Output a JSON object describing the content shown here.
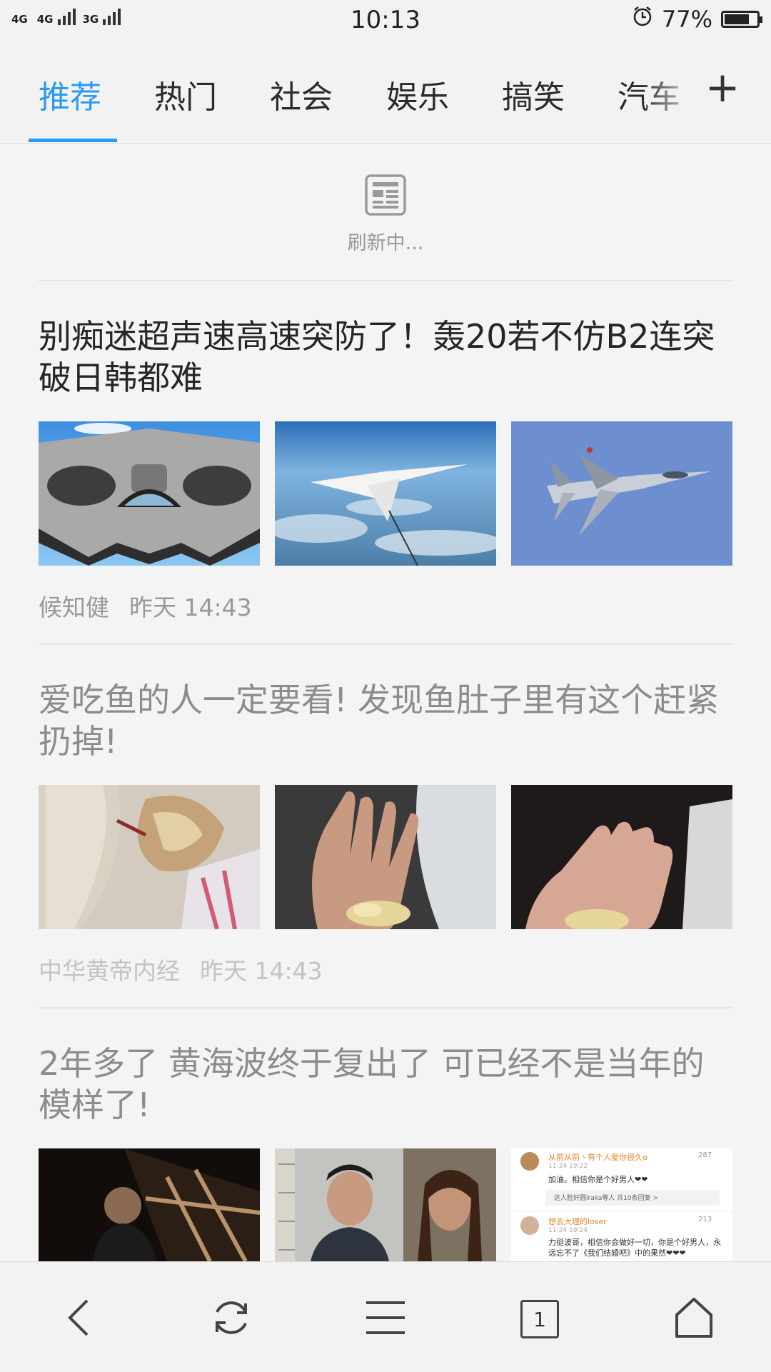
{
  "status_bar": {
    "signal1_label": "4G",
    "signal2_label": "4G",
    "signal3_label": "3G",
    "time": "10:13",
    "alarm_icon": "alarm-clock-icon",
    "battery_percent": "77%",
    "battery_level": 0.77
  },
  "tabs": [
    {
      "label": "推荐",
      "active": true
    },
    {
      "label": "热门"
    },
    {
      "label": "社会"
    },
    {
      "label": "娱乐"
    },
    {
      "label": "搞笑"
    },
    {
      "label": "汽车"
    }
  ],
  "tab_add_label": "+",
  "accent_color": "#2b9af3",
  "refresh": {
    "icon": "news-refresh-icon",
    "text": "刷新中..."
  },
  "articles": [
    {
      "title": "别痴迷超声速高速突防了！轰20若不仿B2连突破日韩都难",
      "source": "候知健",
      "time": "昨天 14:43",
      "images": [
        "stealth-bomber-image",
        "bomber-refueling-image",
        "fighter-jet-image"
      ]
    },
    {
      "title": "爱吃鱼的人一定要看! 发现鱼肚子里有这个赶紧扔掉!",
      "source": "中华黄帝内经",
      "time": "昨天 14:43",
      "images": [
        "fish-belly-image",
        "palm-with-worms-image",
        "hand-with-worms-image"
      ]
    },
    {
      "title": "2年多了 黄海波终于复出了 可已经不是当年的模样了!",
      "images": [
        "actor-portrait-image",
        "mugshot-image",
        "comments-screenshot-image"
      ],
      "comments": [
        {
          "user": "从前从前丶有个人爱你很久ɞ",
          "date": "11-24 19:22",
          "likes": "287",
          "text": "加油。相信你是个好男人❤❤",
          "reply": "这人脸好圆lraka等人 共10条回复 >"
        },
        {
          "user": "想去大理的loser",
          "date": "11-24 19:24",
          "likes": "213",
          "text": "力挺波哥，相信你会做好一切，你是个好男人，永远忘不了《我们结婚吧》中的果然❤❤❤"
        }
      ]
    }
  ],
  "bottom_nav": {
    "back_icon": "back-arrow-icon",
    "refresh_icon": "refresh-icon",
    "menu_icon": "menu-icon",
    "tab_count": "1",
    "home_icon": "home-icon"
  }
}
